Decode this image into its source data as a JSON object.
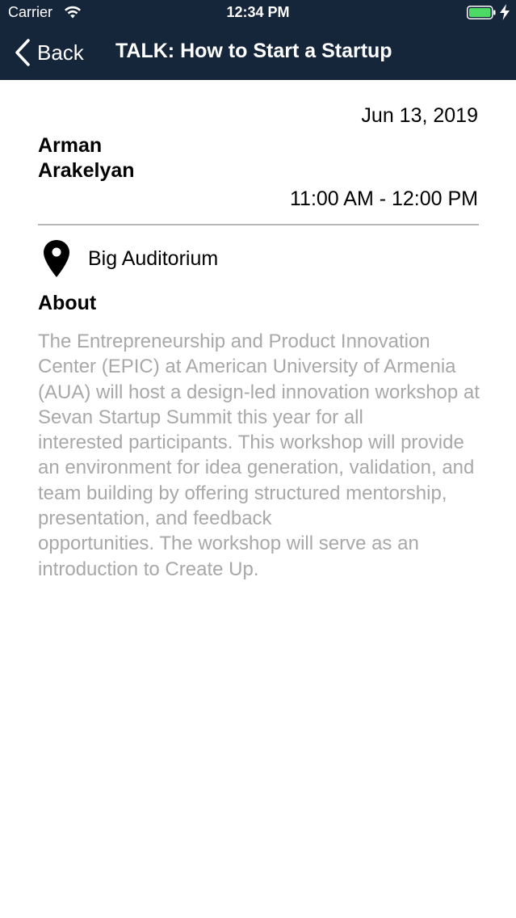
{
  "status_bar": {
    "carrier": "Carrier",
    "time": "12:34 PM",
    "battery_color": "#4cd964"
  },
  "nav": {
    "back_label": "Back",
    "title": "TALK: How to Start a Startup",
    "background_color": "#15253a"
  },
  "event": {
    "date": "Jun 13, 2019",
    "speaker": "Arman\nArakelyan",
    "time_range": "11:00 AM - 12:00 PM",
    "location": "Big Auditorium",
    "about_heading": "About",
    "about_text": "The Entrepreneurship and Product Innovation Center (EPIC) at American University of Armenia\n(AUA) will host a design-led innovation workshop at Sevan Startup Summit this year for all\ninterested participants. This workshop will provide an environment for idea generation, validation, and team building by offering structured mentorship, presentation, and feedback\nopportunities. The workshop will serve as an introduction to Create Up."
  },
  "icons": {
    "back": "chevron-left-icon",
    "location": "map-pin-icon",
    "wifi": "wifi-icon",
    "battery": "battery-icon",
    "charging": "charging-bolt-icon"
  }
}
